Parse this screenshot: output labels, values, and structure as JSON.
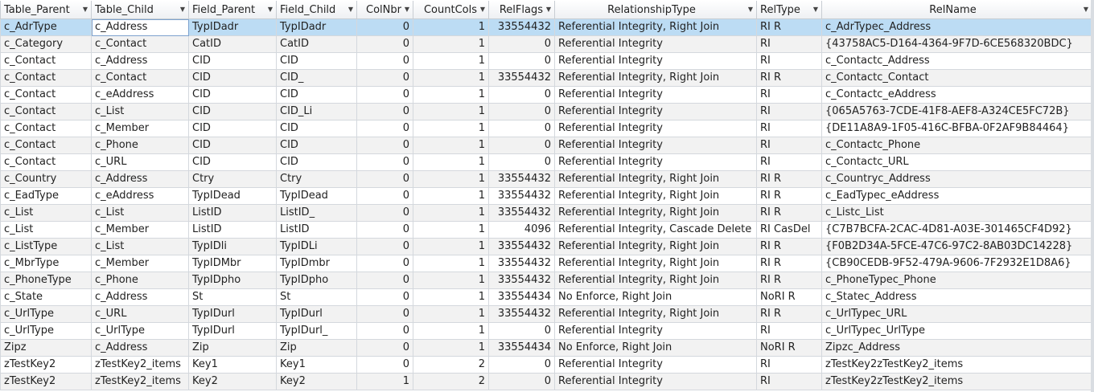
{
  "columns": [
    {
      "key": "table_parent",
      "label": "Table_Parent",
      "align": "left",
      "arrow": "▼"
    },
    {
      "key": "table_child",
      "label": "Table_Child",
      "align": "left",
      "arrow": "▼"
    },
    {
      "key": "field_parent",
      "label": "Field_Parent",
      "align": "left",
      "arrow": "▼"
    },
    {
      "key": "field_child",
      "label": "Field_Child",
      "align": "left",
      "arrow": "▼"
    },
    {
      "key": "colnbr",
      "label": "ColNbr",
      "align": "right",
      "arrow": "▼"
    },
    {
      "key": "countcols",
      "label": "CountCols",
      "align": "right",
      "arrow": "▼"
    },
    {
      "key": "relflags",
      "label": "RelFlags",
      "align": "right",
      "arrow": "▼"
    },
    {
      "key": "relationshiptype",
      "label": "RelationshipType",
      "align": "center",
      "arrow": "▼"
    },
    {
      "key": "reltype",
      "label": "RelType",
      "align": "left",
      "arrow": "▼"
    },
    {
      "key": "relname",
      "label": "RelName",
      "align": "center",
      "arrow": "▼"
    }
  ],
  "selected_row": 0,
  "rows": [
    [
      "c_AdrType",
      "c_Address",
      "TypIDadr",
      "TypIDadr",
      "0",
      "1",
      "33554432",
      "Referential Integrity, Right Join",
      "RI R",
      "c_AdrTypec_Address"
    ],
    [
      "c_Category",
      "c_Contact",
      "CatID",
      "CatID",
      "0",
      "1",
      "0",
      "Referential Integrity",
      "RI",
      "{43758AC5-D164-4364-9F7D-6CE568320BDC}"
    ],
    [
      "c_Contact",
      "c_Address",
      "CID",
      "CID",
      "0",
      "1",
      "0",
      "Referential Integrity",
      "RI",
      "c_Contactc_Address"
    ],
    [
      "c_Contact",
      "c_Contact",
      "CID",
      "CID_",
      "0",
      "1",
      "33554432",
      "Referential Integrity, Right Join",
      "RI R",
      "c_Contactc_Contact"
    ],
    [
      "c_Contact",
      "c_eAddress",
      "CID",
      "CID",
      "0",
      "1",
      "0",
      "Referential Integrity",
      "RI",
      "c_Contactc_eAddress"
    ],
    [
      "c_Contact",
      "c_List",
      "CID",
      "CID_Li",
      "0",
      "1",
      "0",
      "Referential Integrity",
      "RI",
      "{065A5763-7CDE-41F8-AEF8-A324CE5FC72B}"
    ],
    [
      "c_Contact",
      "c_Member",
      "CID",
      "CID",
      "0",
      "1",
      "0",
      "Referential Integrity",
      "RI",
      "{DE11A8A9-1F05-416C-BFBA-0F2AF9B84464}"
    ],
    [
      "c_Contact",
      "c_Phone",
      "CID",
      "CID",
      "0",
      "1",
      "0",
      "Referential Integrity",
      "RI",
      "c_Contactc_Phone"
    ],
    [
      "c_Contact",
      "c_URL",
      "CID",
      "CID",
      "0",
      "1",
      "0",
      "Referential Integrity",
      "RI",
      "c_Contactc_URL"
    ],
    [
      "c_Country",
      "c_Address",
      "Ctry",
      "Ctry",
      "0",
      "1",
      "33554432",
      "Referential Integrity, Right Join",
      "RI R",
      "c_Countryc_Address"
    ],
    [
      "c_EadType",
      "c_eAddress",
      "TypIDead",
      "TypIDead",
      "0",
      "1",
      "33554432",
      "Referential Integrity, Right Join",
      "RI R",
      "c_EadTypec_eAddress"
    ],
    [
      "c_List",
      "c_List",
      "ListID",
      "ListID_",
      "0",
      "1",
      "33554432",
      "Referential Integrity, Right Join",
      "RI R",
      "c_Listc_List"
    ],
    [
      "c_List",
      "c_Member",
      "ListID",
      "ListID",
      "0",
      "1",
      "4096",
      "Referential Integrity, Cascade Delete",
      "RI CasDel",
      "{C7B7BCFA-2CAC-4D81-A03E-301465CF4D92}"
    ],
    [
      "c_ListType",
      "c_List",
      "TypIDli",
      "TypIDLi",
      "0",
      "1",
      "33554432",
      "Referential Integrity, Right Join",
      "RI R",
      "{F0B2D34A-5FCE-47C6-97C2-8AB03DC14228}"
    ],
    [
      "c_MbrType",
      "c_Member",
      "TypIDMbr",
      "TypIDmbr",
      "0",
      "1",
      "33554432",
      "Referential Integrity, Right Join",
      "RI R",
      "{CB90CEDB-9F52-479A-9606-7F2932E1D8A6}"
    ],
    [
      "c_PhoneType",
      "c_Phone",
      "TypIDpho",
      "TypIDpho",
      "0",
      "1",
      "33554432",
      "Referential Integrity, Right Join",
      "RI R",
      "c_PhoneTypec_Phone"
    ],
    [
      "c_State",
      "c_Address",
      "St",
      "St",
      "0",
      "1",
      "33554434",
      "No Enforce, Right Join",
      "NoRI R",
      "c_Statec_Address"
    ],
    [
      "c_UrlType",
      "c_URL",
      "TypIDurl",
      "TypIDurl",
      "0",
      "1",
      "33554432",
      "Referential Integrity, Right Join",
      "RI R",
      "c_UrlTypec_URL"
    ],
    [
      "c_UrlType",
      "c_UrlType",
      "TypIDurl",
      "TypIDurl_",
      "0",
      "1",
      "0",
      "Referential Integrity",
      "RI",
      "c_UrlTypec_UrlType"
    ],
    [
      "Zipz",
      "c_Address",
      "Zip",
      "Zip",
      "0",
      "1",
      "33554434",
      "No Enforce, Right Join",
      "NoRI R",
      "Zipzc_Address"
    ],
    [
      "zTestKey2",
      "zTestKey2_items",
      "Key1",
      "Key1",
      "0",
      "2",
      "0",
      "Referential Integrity",
      "RI",
      "zTestKey2zTestKey2_items"
    ],
    [
      "zTestKey2",
      "zTestKey2_items",
      "Key2",
      "Key2",
      "1",
      "2",
      "0",
      "Referential Integrity",
      "RI",
      "zTestKey2zTestKey2_items"
    ]
  ]
}
